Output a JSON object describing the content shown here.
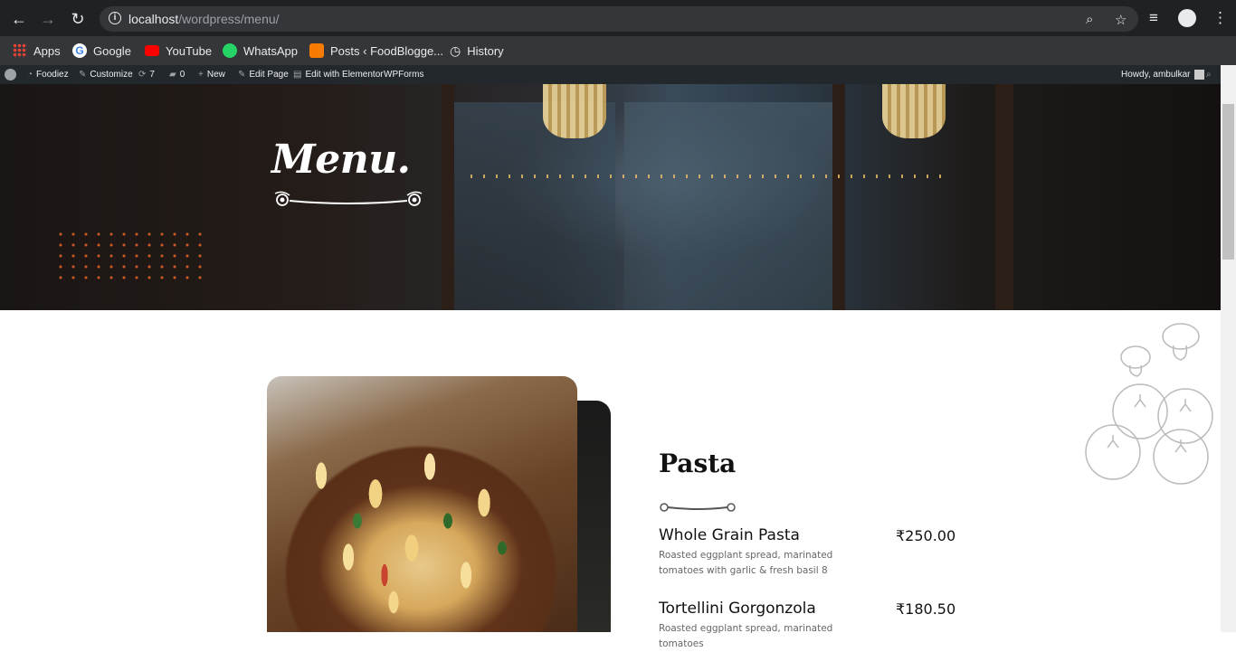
{
  "browser": {
    "url_host": "localhost",
    "url_path": "/wordpress/menu/",
    "bookmarks": [
      {
        "label": "Apps",
        "color": "#4285f4"
      },
      {
        "label": "Google",
        "color": "#ffffff"
      },
      {
        "label": "YouTube",
        "color": "#ff0000"
      },
      {
        "label": "WhatsApp",
        "color": "#25d366"
      },
      {
        "label": "Posts ‹ FoodBlogge...",
        "color": "#f57c00"
      },
      {
        "label": "History",
        "color": "#e8eaed"
      }
    ]
  },
  "wp_admin_bar": {
    "site_name": "Foodiez",
    "customize": "Customize",
    "updates_count": "7",
    "comments_count": "0",
    "new": "New",
    "edit_page": "Edit Page",
    "edit_elementor": "Edit with Elementor",
    "wpforms": "WPForms",
    "howdy": "Howdy, ambulkar"
  },
  "hero": {
    "title": "Menu."
  },
  "menu_section": {
    "title": "Pasta",
    "items": [
      {
        "name": "Whole Grain Pasta",
        "price": "₹250.00",
        "description": "Roasted eggplant spread, marinated tomatoes with garlic & fresh basil 8"
      },
      {
        "name": "Tortellini Gorgonzola",
        "price": "₹180.50",
        "description": "Roasted eggplant spread, marinated tomatoes"
      }
    ]
  }
}
